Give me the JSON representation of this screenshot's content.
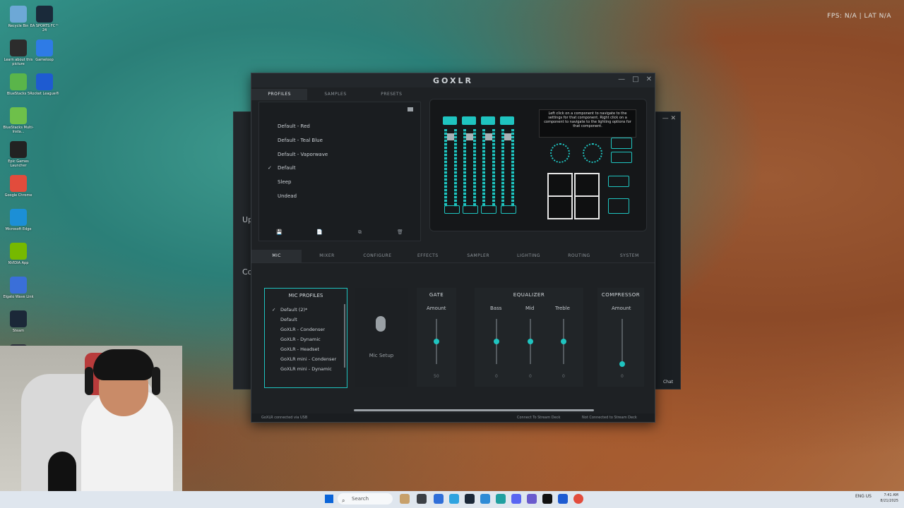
{
  "desktop": {
    "icons": [
      {
        "label": "Recycle Bin",
        "color": "#6da8d6"
      },
      {
        "label": "EA SPORTS FC™ 24",
        "color": "#1a2a3a"
      },
      {
        "label": "Learn about this picture",
        "color": "#2c2c2c"
      },
      {
        "label": "Gameloop",
        "color": "#2e7be6"
      },
      {
        "label": "BlueStacks 5",
        "color": "#5ab54a"
      },
      {
        "label": "Rocket League®",
        "color": "#1e5bd1"
      },
      {
        "label": "BlueStacks Multi-Insta...",
        "color": "#6ec04a"
      },
      {
        "label": "Epic Games Launcher",
        "color": "#222222"
      },
      {
        "label": "Google Chrome",
        "color": "#e24c3c"
      },
      {
        "label": "Microsoft Edge",
        "color": "#1c8fd6"
      },
      {
        "label": "NVIDIA App",
        "color": "#76b900"
      },
      {
        "label": "Elgato Wave Link",
        "color": "#3a6fd9"
      },
      {
        "label": "Steam",
        "color": "#1b2838"
      },
      {
        "label": "Elgato Stream Deck",
        "color": "#2b2f3a"
      },
      {
        "label": "Intel Tools Portable",
        "color": "#d94d2e"
      },
      {
        "label": "New folder",
        "color": "#f2c14e"
      },
      {
        "label": "Discord",
        "color": "#5865f2"
      }
    ],
    "hud_text": "FPS: N/A | LAT N/A"
  },
  "bg_window": {
    "text_up": "Up",
    "text_co": "Co",
    "text_chat": "Chat"
  },
  "goxlr": {
    "title": "GOXLR",
    "window_controls": [
      "—",
      "□",
      "✕"
    ],
    "top_tabs": [
      "PROFILES",
      "SAMPLES",
      "PRESETS"
    ],
    "profiles": [
      "Default - Red",
      "Default - Teal Blue",
      "Default - Vaporwave",
      "Default",
      "Sleep",
      "Undead"
    ],
    "active_profile_check": "✓",
    "profile_actions": [
      "💾",
      "📄",
      "⧉",
      "🗑"
    ],
    "tooltip": "Left click on a component to navigate to the settings for that component. Right click on a component to navigate to the lighting options for that component.",
    "main_tabs": [
      "MIC",
      "MIXER",
      "CONFIGURE",
      "EFFECTS",
      "SAMPLER",
      "LIGHTING",
      "ROUTING",
      "SYSTEM"
    ],
    "mic_profiles": {
      "title": "MIC PROFILES",
      "items": [
        "Default (2)*",
        "Default",
        "GoXLR - Condenser",
        "GoXLR - Dynamic",
        "GoXLR - Headset",
        "GoXLR mini - Condenser",
        "GoXLR mini - Dynamic"
      ],
      "check": "✓"
    },
    "mic_setup": {
      "label": "Mic Setup"
    },
    "gate": {
      "title": "GATE",
      "label": "Amount",
      "value": "50",
      "level": 0.5
    },
    "equalizer": {
      "title": "EQUALIZER",
      "bands": [
        {
          "label": "Bass",
          "value": "0",
          "level": 0.5
        },
        {
          "label": "Mid",
          "value": "0",
          "level": 0.5
        },
        {
          "label": "Treble",
          "value": "0",
          "level": 0.5
        }
      ]
    },
    "compressor": {
      "title": "COMPRESSOR",
      "label": "Amount",
      "value": "0",
      "level": 0.0
    },
    "status": {
      "left": "GoXLR connected via USB",
      "middle": "Connect To Stream Deck",
      "right": "Not Connected to Stream Deck"
    },
    "accent": "#1fc4c0"
  },
  "taskbar": {
    "search_placeholder": "Search",
    "tray": "ENG US",
    "time": "7:41 AM",
    "date": "8/21/2025"
  }
}
